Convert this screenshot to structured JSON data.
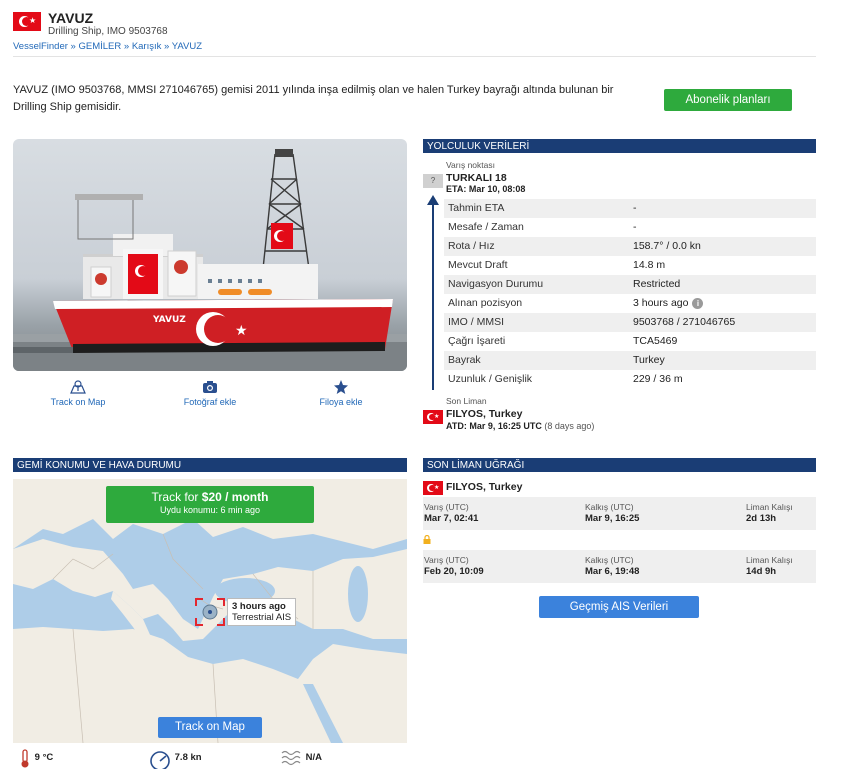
{
  "header": {
    "ship_name": "YAVUZ",
    "ship_subtitle": "Drilling Ship, IMO 9503768",
    "breadcrumb": [
      "VesselFinder",
      "GEMİLER",
      "Karışık",
      "YAVUZ"
    ],
    "breadcrumb_sep": " » "
  },
  "intro_text": "YAVUZ (IMO 9503768, MMSI 271046765) gemisi 2011 yılında inşa edilmiş olan ve halen Turkey bayrağı altında bulunan bir Drilling Ship gemisidir.",
  "subscribe_button": "Abonelik planları",
  "photo_actions": {
    "map": "Track on Map",
    "photo": "Fotoğraf ekle",
    "fleet": "Filoya ekle"
  },
  "voyage": {
    "section_title": "YOLCULUK VERİLERİ",
    "destination_label": "Varış noktası",
    "unknown_flag": "?",
    "destination": "TURKALI 18",
    "eta": "ETA: Mar 10, 08:08",
    "rows": [
      {
        "k": "Tahmin ETA",
        "v": "-"
      },
      {
        "k": "Mesafe / Zaman",
        "v": "-"
      },
      {
        "k": "Rota / Hız",
        "v": "158.7° / 0.0 kn"
      },
      {
        "k": "Mevcut Draft",
        "v": "14.8 m"
      },
      {
        "k": "Navigasyon Durumu",
        "v": "Restricted"
      },
      {
        "k": "Alınan pozisyon",
        "v": "3 hours ago"
      },
      {
        "k": "IMO / MMSI",
        "v": "9503768 / 271046765"
      },
      {
        "k": "Çağrı İşareti",
        "v": "TCA5469"
      },
      {
        "k": "Bayrak",
        "v": "Turkey"
      },
      {
        "k": "Uzunluk / Genişlik",
        "v": "229 / 36 m"
      }
    ],
    "info_glyph": "i",
    "last_port_label": "Son Liman",
    "last_port": "FILYOS, Turkey",
    "atd": "ATD: Mar 9, 16:25 UTC",
    "atd_ago": "(8 days ago)"
  },
  "map_section": {
    "title": "GEMİ KONUMU VE HAVA DURUMU",
    "track_price_prefix": "Track for ",
    "track_price": "$20 / month",
    "track_sub": "Uydu konumu: 6 min ago",
    "tip_time": "3 hours ago",
    "tip_source": "Terrestrial AIS",
    "track_button": "Track on Map",
    "weather": [
      {
        "icon": "thermometer-icon",
        "value": "9 °C"
      },
      {
        "icon": "wind-gauge-icon",
        "value": "7.8 kn"
      },
      {
        "icon": "wave-icon",
        "value": "N/A"
      }
    ]
  },
  "port_calls": {
    "title": "SON LİMAN UĞRAĞI",
    "port": "FILYOS, Turkey",
    "calls": [
      {
        "arr_label": "Varış (UTC)",
        "arr": "Mar 7, 02:41",
        "dep_label": "Kalkış (UTC)",
        "dep": "Mar 9, 16:25",
        "stay_label": "Liman Kalışı",
        "stay": "2d 13h"
      },
      {
        "arr_label": "Varış (UTC)",
        "arr": "Feb 20, 10:09",
        "dep_label": "Kalkış (UTC)",
        "dep": "Mar 6, 19:48",
        "stay_label": "Liman Kalışı",
        "stay": "14d 9h"
      }
    ],
    "history_button": "Geçmiş AIS Verileri"
  },
  "colors": {
    "section_header": "#1a3d75",
    "green": "#2eaa3d",
    "blue_button": "#3b82dc",
    "link": "#2269b8",
    "turkey_red": "#e30a17"
  }
}
